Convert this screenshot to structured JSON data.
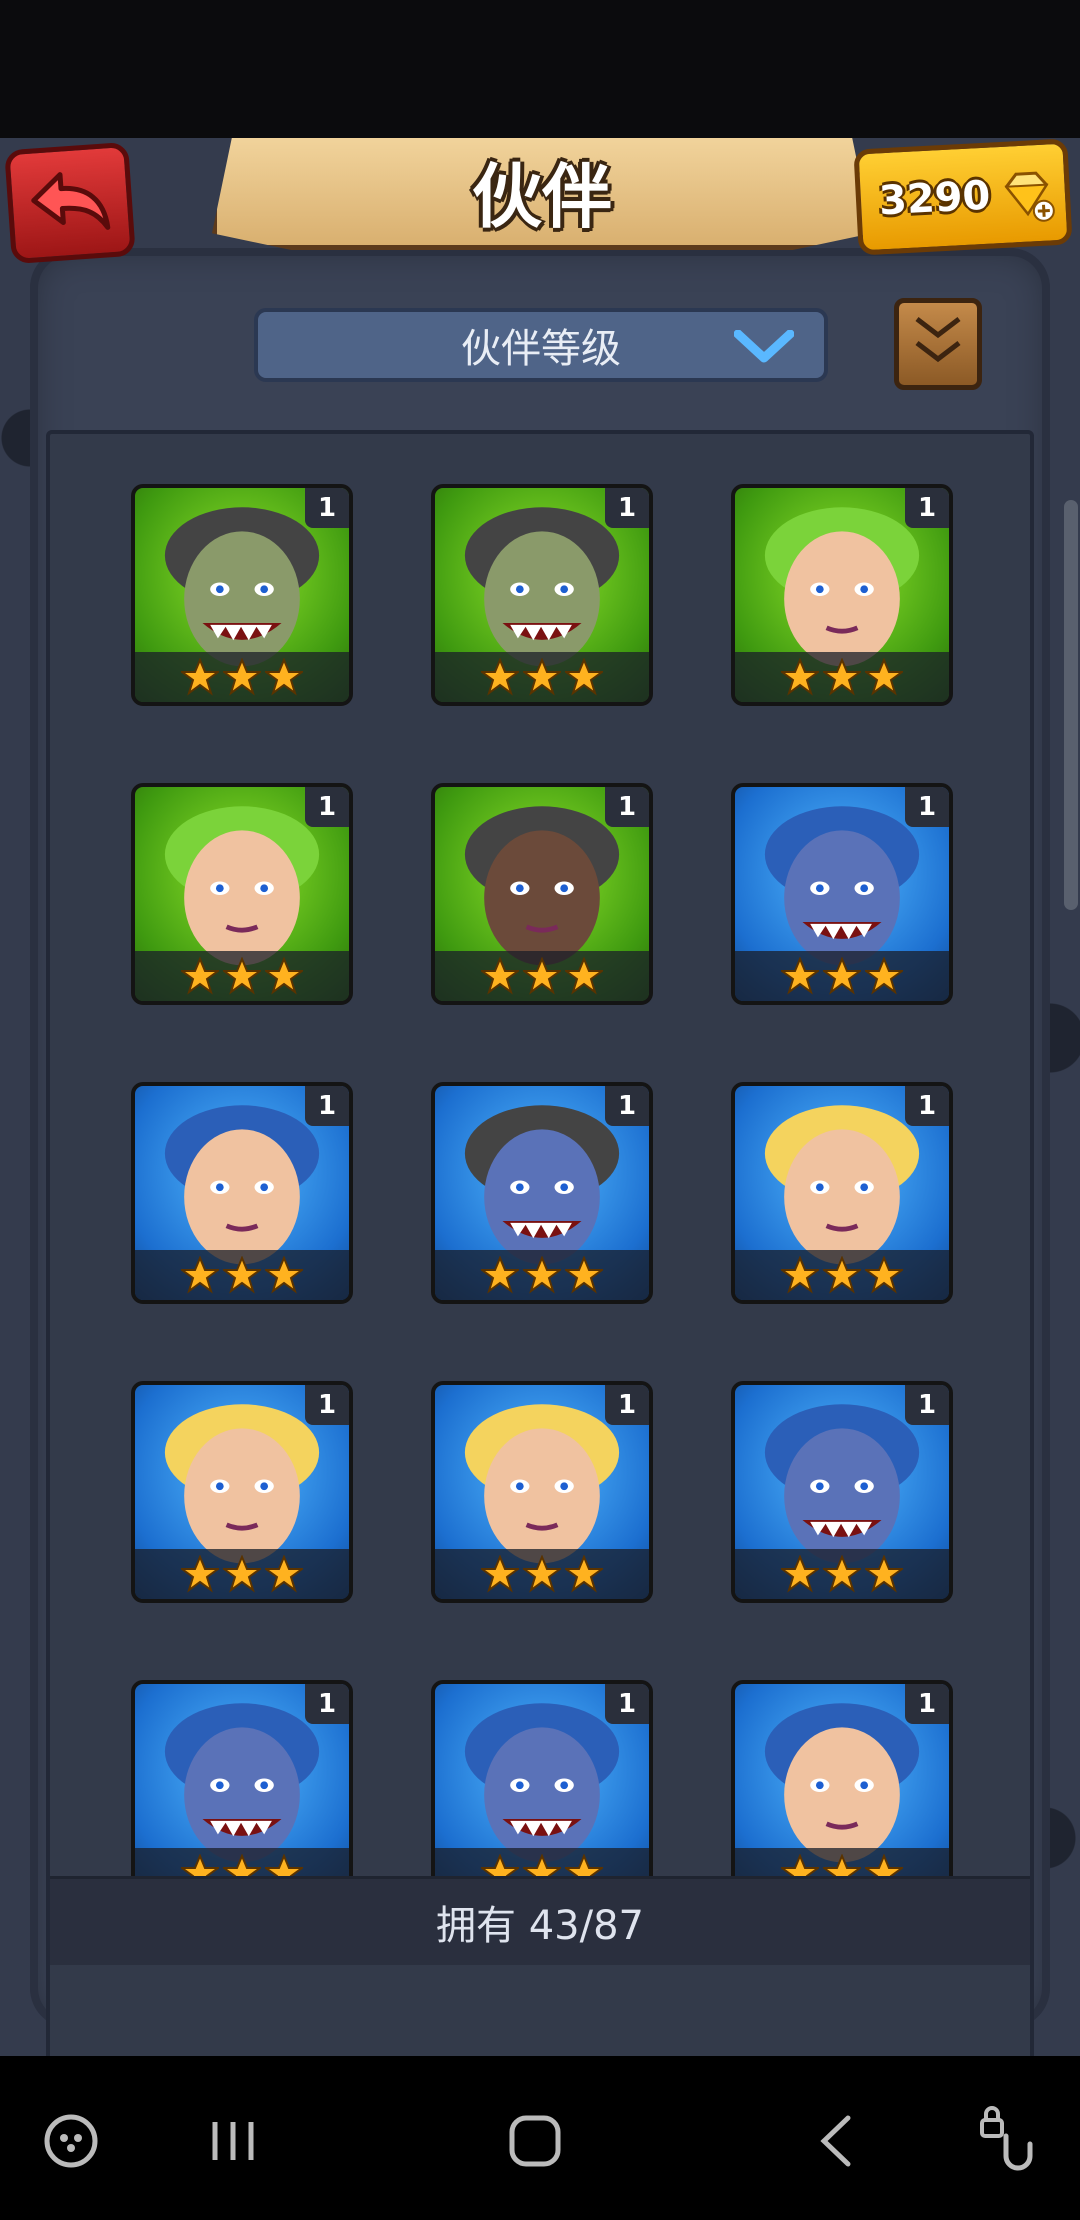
{
  "header": {
    "title": "伙伴",
    "currency_amount": "3290",
    "back_icon": "back-arrow-icon",
    "gem_icon": "gem-plus-icon"
  },
  "sort_dropdown": {
    "selected_label": "伙伴等级",
    "icon": "chevron-down-icon"
  },
  "book_icon": "scroll-book-icon",
  "companions": [
    {
      "name": "grey-wolf",
      "bg": "green",
      "level": "1",
      "stars": 3
    },
    {
      "name": "green-crocodile",
      "bg": "green",
      "level": "1",
      "stars": 3
    },
    {
      "name": "leaf-hair-girl",
      "bg": "green",
      "level": "1",
      "stars": 3
    },
    {
      "name": "leaf-hair-girl",
      "bg": "green",
      "level": "1",
      "stars": 3
    },
    {
      "name": "skull-helm-warrior",
      "bg": "green",
      "level": "1",
      "stars": 3
    },
    {
      "name": "blue-wolf",
      "bg": "blue",
      "level": "1",
      "stars": 3
    },
    {
      "name": "blue-beard-barbarian",
      "bg": "blue",
      "level": "1",
      "stars": 3
    },
    {
      "name": "grey-brute",
      "bg": "blue",
      "level": "1",
      "stars": 3
    },
    {
      "name": "blonde-huntress",
      "bg": "blue",
      "level": "1",
      "stars": 3
    },
    {
      "name": "blonde-huntress",
      "bg": "blue",
      "level": "1",
      "stars": 3
    },
    {
      "name": "blonde-huntress",
      "bg": "blue",
      "level": "1",
      "stars": 3
    },
    {
      "name": "blue-boar",
      "bg": "blue",
      "level": "1",
      "stars": 3
    },
    {
      "name": "blue-boar",
      "bg": "blue",
      "level": "1",
      "stars": 3
    },
    {
      "name": "blue-crocodile",
      "bg": "blue",
      "level": "1",
      "stars": 3
    },
    {
      "name": "blue-hair-girl",
      "bg": "blue",
      "level": "1",
      "stars": 3
    }
  ],
  "owned": {
    "text": "拥有 43/87"
  },
  "navbar": {
    "items": [
      "game-launcher-icon",
      "recent-apps-icon",
      "home-icon",
      "back-icon",
      "touch-lock-icon"
    ]
  },
  "colors": {
    "green_card": "#4fb51a",
    "blue_card": "#1c6fd0",
    "star": "#ffb21f",
    "currency": "#f2b21c",
    "back_button": "#c42424"
  }
}
